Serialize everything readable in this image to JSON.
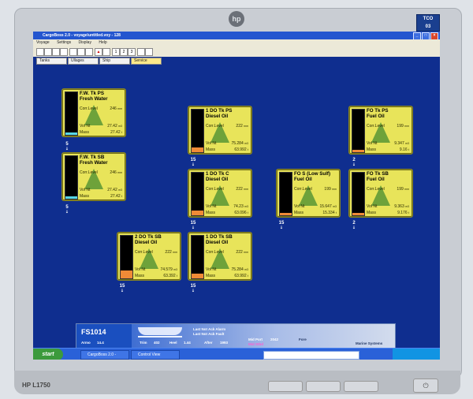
{
  "window": {
    "title": "CargoBoss 2.0 - voyage\\untitled.voy - 128"
  },
  "menu": [
    "Voyage",
    "Settings",
    "Display",
    "Help"
  ],
  "toolbar_numbers": [
    "1",
    "2",
    "3"
  ],
  "tabs": [
    {
      "label": "Tanks",
      "active": false
    },
    {
      "label": "Ullages",
      "active": false
    },
    {
      "label": "Ship",
      "active": false
    },
    {
      "label": "Service",
      "active": true
    }
  ],
  "tanks": [
    {
      "name": "F.W. Tk PS",
      "product": "Fresh Water",
      "corr_level_label": "Corr.Level",
      "corr_level": "246",
      "corr_unit": "mm",
      "vol_label": "Vol Nt",
      "vol": "27.42",
      "vol_unit": "m3",
      "mass_label": "Mass",
      "mass": "27.42",
      "mass_unit": "t",
      "number": "5",
      "kind": "water",
      "fill_pct": 6
    },
    {
      "name": "F.W. Tk SB",
      "product": "Fresh Water",
      "corr_level_label": "Corr.Level",
      "corr_level": "246",
      "corr_unit": "mm",
      "vol_label": "Vol Nt",
      "vol": "27.42",
      "vol_unit": "m3",
      "mass_label": "Mass",
      "mass": "27.42",
      "mass_unit": "t",
      "number": "5",
      "kind": "water",
      "fill_pct": 6
    },
    {
      "name": "1 DO Tk PS",
      "product": "Diesel Oil",
      "corr_level_label": "Corr.Level",
      "corr_level": "222",
      "corr_unit": "mm",
      "vol_label": "Vol Nt",
      "vol": "75.284",
      "vol_unit": "m3",
      "mass_label": "Mass",
      "mass": "63.992",
      "mass_unit": "t",
      "number": "15",
      "kind": "oil",
      "fill_pct": 12
    },
    {
      "name": "1 DO Tk C",
      "product": "Diesel Oil",
      "corr_level_label": "Corr.Level",
      "corr_level": "222",
      "corr_unit": "mm",
      "vol_label": "Vol Nt",
      "vol": "74.23",
      "vol_unit": "m3",
      "mass_label": "Mass",
      "mass": "63.096",
      "mass_unit": "t",
      "number": "15",
      "kind": "oil",
      "fill_pct": 12
    },
    {
      "name": "1 DO Tk SB",
      "product": "Diesel Oil",
      "corr_level_label": "Corr.Level",
      "corr_level": "222",
      "corr_unit": "mm",
      "vol_label": "Vol Nt",
      "vol": "75.284",
      "vol_unit": "m3",
      "mass_label": "Mass",
      "mass": "63.992",
      "mass_unit": "t",
      "number": "15",
      "kind": "oil",
      "fill_pct": 12
    },
    {
      "name": "2 DO Tk SB",
      "product": "Diesel Oil",
      "corr_level_label": "Corr.Level",
      "corr_level": "222",
      "corr_unit": "mm",
      "vol_label": "Vol Nt",
      "vol": "74.579",
      "vol_unit": "m3",
      "mass_label": "Mass",
      "mass": "63.392",
      "mass_unit": "t",
      "number": "15",
      "kind": "oil",
      "fill_pct": 18
    },
    {
      "name": "FO S (Low Sulf)",
      "product": "Fuel Oil",
      "corr_level_label": "Corr.Level",
      "corr_level": "199",
      "corr_unit": "mm",
      "vol_label": "Vol Nt",
      "vol": "15.647",
      "vol_unit": "m3",
      "mass_label": "Mass",
      "mass": "15.334",
      "mass_unit": "t",
      "number": "15",
      "kind": "oil",
      "fill_pct": 5
    },
    {
      "name": "FO Tk PS",
      "product": "Fuel Oil",
      "corr_level_label": "Corr.Level",
      "corr_level": "199",
      "corr_unit": "mm",
      "vol_label": "Vol Nt",
      "vol": "9.347",
      "vol_unit": "m3",
      "mass_label": "Mass",
      "mass": "9.16",
      "mass_unit": "t",
      "number": "2",
      "kind": "oil",
      "fill_pct": 5
    },
    {
      "name": "FO Tk SB",
      "product": "Fuel Oil",
      "corr_level_label": "Corr.Level",
      "corr_level": "199",
      "corr_unit": "mm",
      "vol_label": "Vol Nt",
      "vol": "9.363",
      "vol_unit": "m3",
      "mass_label": "Mass",
      "mass": "9.176",
      "mass_unit": "t",
      "number": "2",
      "kind": "oil",
      "fill_pct": 5
    }
  ],
  "status": {
    "id": "FS1014",
    "armo_label": "Armo",
    "armo": "14.4",
    "trim_label": "Trim",
    "trim": "402",
    "heel_label": "Heel",
    "heel": "1.44",
    "after_label": "After",
    "after": "1993",
    "mid_port_label": "Mid Port",
    "mid_port": "2042",
    "mid_stbd_label": "Mid Stbd",
    "fore_label": "Fore",
    "alarm": "Last Not Ack Alarm",
    "fault": "Last Not Ack Fault",
    "brand": "Marine Systems"
  },
  "taskbar": {
    "start": "start",
    "tasks": [
      "CargoBoss 2.0 - voya...",
      "Control View"
    ]
  },
  "monitor": {
    "brand": "hp",
    "model": "HP L1750"
  }
}
